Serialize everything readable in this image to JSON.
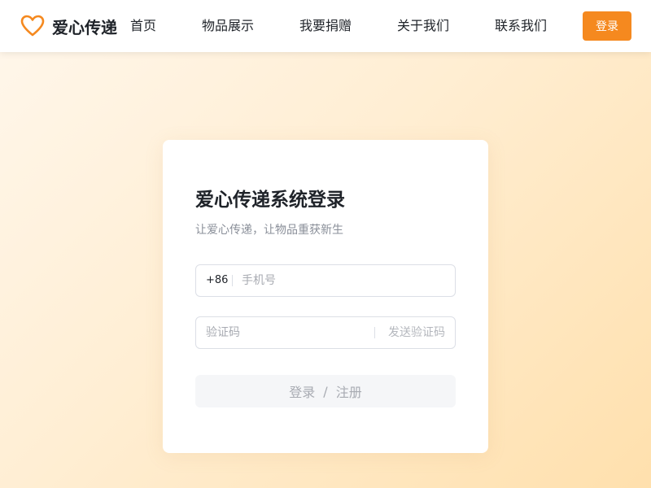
{
  "header": {
    "logo_text": "爱心传递",
    "nav": [
      {
        "label": "首页"
      },
      {
        "label": "物品展示"
      },
      {
        "label": "我要捐赠"
      },
      {
        "label": "关于我们"
      },
      {
        "label": "联系我们"
      }
    ],
    "login_label": "登录"
  },
  "login_card": {
    "title": "爱心传递系统登录",
    "subtitle": "让爱心传递，让物品重获新生",
    "phone_prefix": "+86",
    "phone_placeholder": "手机号",
    "phone_value": "",
    "code_placeholder": "验证码",
    "code_value": "",
    "send_code_label": "发送验证码",
    "submit": {
      "login": "登录",
      "separator": "/",
      "register": "注册"
    }
  },
  "colors": {
    "accent": "#f5891f",
    "text": "#1f2329",
    "muted": "#8a8f99",
    "border": "#dcdfe6",
    "disabled_bg": "#f5f6f8"
  }
}
